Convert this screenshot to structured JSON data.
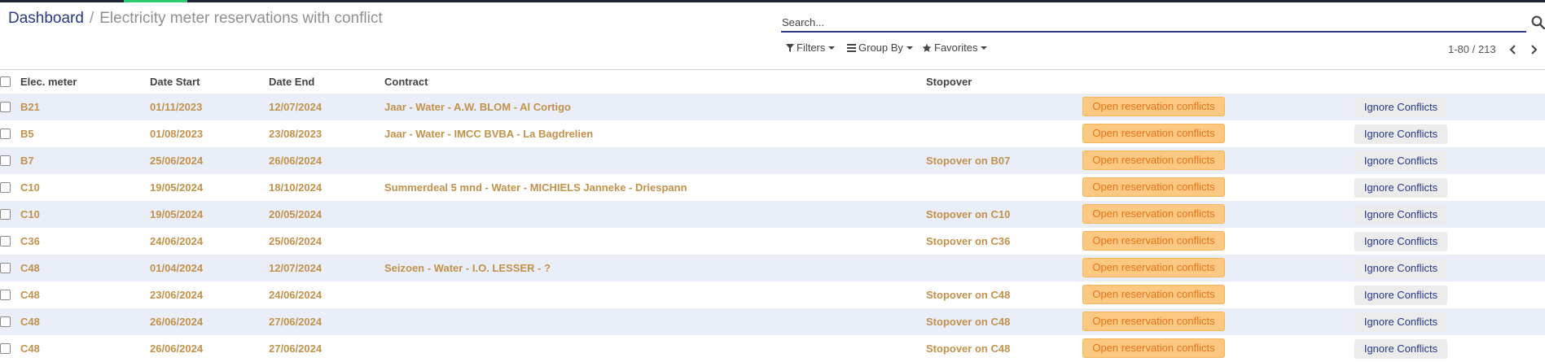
{
  "breadcrumb": {
    "root": "Dashboard",
    "separator": "/",
    "current": "Electricity meter reservations with conflict"
  },
  "search": {
    "placeholder": "Search...",
    "value": ""
  },
  "toolbar": {
    "filters_label": "Filters",
    "group_by_label": "Group By",
    "favorites_label": "Favorites"
  },
  "pager": {
    "label": "1-80 / 213"
  },
  "table": {
    "headers": {
      "meter": "Elec. meter",
      "date_start": "Date Start",
      "date_end": "Date End",
      "contract": "Contract",
      "stopover": "Stopover"
    },
    "rows": [
      {
        "meter": "B21",
        "date_start": "01/11/2023",
        "date_end": "12/07/2024",
        "contract": "Jaar - Water - A.W. BLOM - Al Cortigo",
        "stopover": "",
        "conflict_label": "Open reservation conflicts",
        "ignore_label": "Ignore Conflicts"
      },
      {
        "meter": "B5",
        "date_start": "01/08/2023",
        "date_end": "23/08/2023",
        "contract": "Jaar - Water - IMCC BVBA - La Bagdrelien",
        "stopover": "",
        "conflict_label": "Open reservation conflicts",
        "ignore_label": "Ignore Conflicts"
      },
      {
        "meter": "B7",
        "date_start": "25/06/2024",
        "date_end": "26/06/2024",
        "contract": "",
        "stopover": "Stopover on B07",
        "conflict_label": "Open reservation conflicts",
        "ignore_label": "Ignore Conflicts"
      },
      {
        "meter": "C10",
        "date_start": "19/05/2024",
        "date_end": "18/10/2024",
        "contract": "Summerdeal 5 mnd - Water - MICHIELS Janneke - Driespann",
        "stopover": "",
        "conflict_label": "Open reservation conflicts",
        "ignore_label": "Ignore Conflicts"
      },
      {
        "meter": "C10",
        "date_start": "19/05/2024",
        "date_end": "20/05/2024",
        "contract": "",
        "stopover": "Stopover on C10",
        "conflict_label": "Open reservation conflicts",
        "ignore_label": "Ignore Conflicts"
      },
      {
        "meter": "C36",
        "date_start": "24/06/2024",
        "date_end": "25/06/2024",
        "contract": "",
        "stopover": "Stopover on C36",
        "conflict_label": "Open reservation conflicts",
        "ignore_label": "Ignore Conflicts"
      },
      {
        "meter": "C48",
        "date_start": "01/04/2024",
        "date_end": "12/07/2024",
        "contract": "Seizoen - Water - I.O. LESSER - ?",
        "stopover": "",
        "conflict_label": "Open reservation conflicts",
        "ignore_label": "Ignore Conflicts"
      },
      {
        "meter": "C48",
        "date_start": "23/06/2024",
        "date_end": "24/06/2024",
        "contract": "",
        "stopover": "Stopover on C48",
        "conflict_label": "Open reservation conflicts",
        "ignore_label": "Ignore Conflicts"
      },
      {
        "meter": "C48",
        "date_start": "26/06/2024",
        "date_end": "27/06/2024",
        "contract": "",
        "stopover": "Stopover on C48",
        "conflict_label": "Open reservation conflicts",
        "ignore_label": "Ignore Conflicts"
      },
      {
        "meter": "C48",
        "date_start": "26/06/2024",
        "date_end": "27/06/2024",
        "contract": "",
        "stopover": "Stopover on C48",
        "conflict_label": "Open reservation conflicts",
        "ignore_label": "Ignore Conflicts"
      }
    ]
  },
  "colors": {
    "brand": "#28388f",
    "row_text": "#c3924a",
    "row_alt_bg": "#eaeef8",
    "badge_bg": "#fdc982",
    "badge_text": "#e8731a",
    "topbar": "#1f2433",
    "topbar_accent": "#2ecc71"
  },
  "icons": {
    "search": "search-icon",
    "filter": "filter-icon",
    "group_by": "bars-icon",
    "favorites": "star-icon",
    "prev": "chevron-left-icon",
    "next": "chevron-right-icon"
  }
}
